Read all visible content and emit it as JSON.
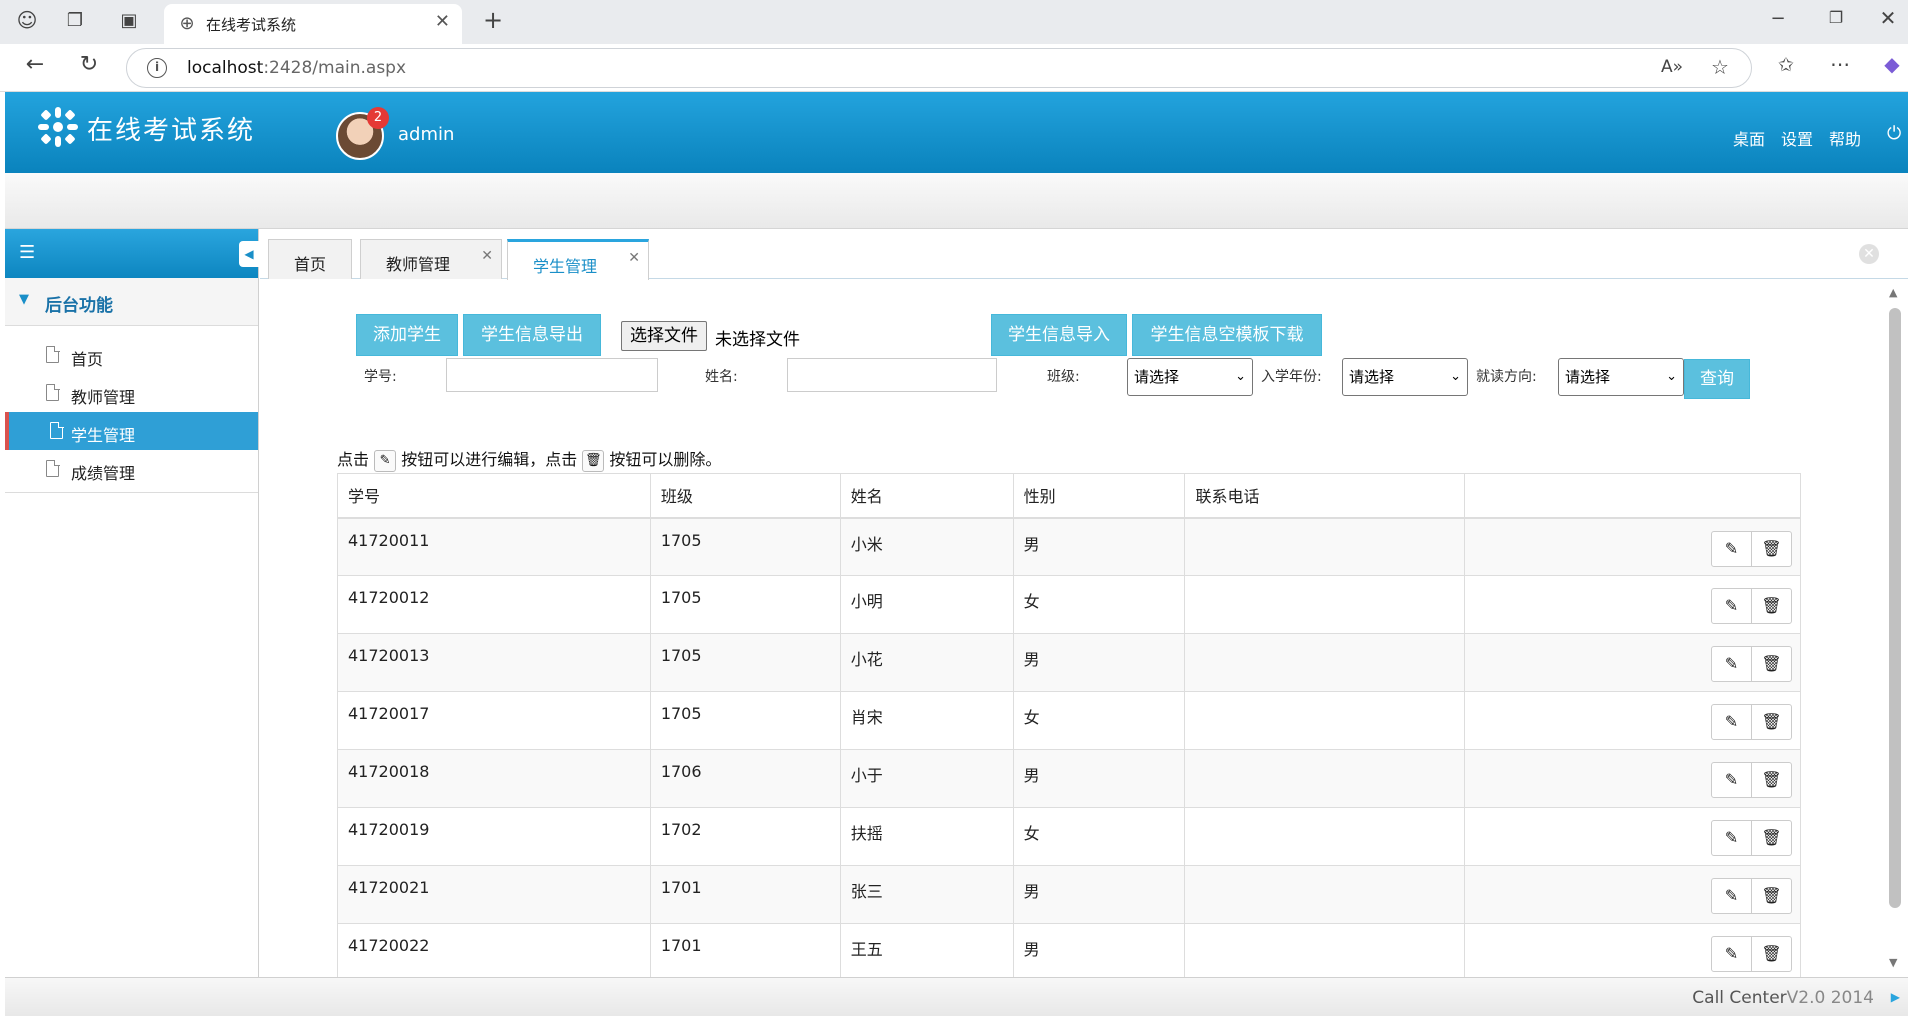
{
  "browser": {
    "tab_title": "在线考试系统",
    "url_host": "localhost",
    "url_rest": ":2428/main.aspx",
    "icons": [
      "profile-icon",
      "collections-icon",
      "vertical-tabs-icon",
      "globe-icon",
      "close-icon",
      "new-tab-icon",
      "back-icon",
      "reload-icon",
      "info-icon",
      "read-aloud-icon",
      "favorite-icon",
      "favorites-list-icon",
      "more-icon",
      "copilot-icon",
      "minimize-icon",
      "restore-icon",
      "window-close-icon"
    ]
  },
  "header": {
    "title": "在线考试系统",
    "username": "admin",
    "notification_count": "2",
    "nav": {
      "desktop": "桌面",
      "settings": "设置",
      "help": "帮助"
    }
  },
  "sidebar": {
    "section_label": "后台功能",
    "items": [
      {
        "label": "首页"
      },
      {
        "label": "教师管理"
      },
      {
        "label": "学生管理"
      },
      {
        "label": "成绩管理"
      }
    ],
    "active_index": 2
  },
  "tabs": [
    {
      "label": "首页"
    },
    {
      "label": "教师管理"
    },
    {
      "label": "学生管理"
    }
  ],
  "toolbar": {
    "add_student": "添加学生",
    "export": "学生信息导出",
    "choose_file": "选择文件",
    "no_file": "未选择文件",
    "import": "学生信息导入",
    "template_download": "学生信息空模板下载"
  },
  "filters": {
    "student_no_label": "学号:",
    "name_label": "姓名:",
    "class_label": "班级:",
    "class_value": "请选择",
    "year_label": "入学年份:",
    "year_value": "请选择",
    "direction_label": "就读方向:",
    "direction_value": "请选择",
    "query": "查询"
  },
  "hint": {
    "part1": "点击",
    "part2": "按钮可以进行编辑，点击",
    "part3": "按钮可以删除。"
  },
  "table": {
    "headers": [
      "学号",
      "班级",
      "姓名",
      "性别",
      "联系电话",
      ""
    ],
    "rows": [
      [
        "41720011",
        "1705",
        "小米",
        "男",
        ""
      ],
      [
        "41720012",
        "1705",
        "小明",
        "女",
        ""
      ],
      [
        "41720013",
        "1705",
        "小花",
        "男",
        ""
      ],
      [
        "41720017",
        "1705",
        "肖宋",
        "女",
        ""
      ],
      [
        "41720018",
        "1706",
        "小于",
        "男",
        ""
      ],
      [
        "41720019",
        "1702",
        "扶摇",
        "女",
        ""
      ],
      [
        "41720021",
        "1701",
        "张三",
        "男",
        ""
      ],
      [
        "41720022",
        "1701",
        "王五",
        "男",
        ""
      ]
    ]
  },
  "footer": {
    "text_main": "Call Center",
    "text_dim": "V2.0 2014"
  },
  "colors": {
    "header_blue": "#0a83bd",
    "button_cyan": "#5bc0de",
    "active_accent": "#d9534f"
  }
}
